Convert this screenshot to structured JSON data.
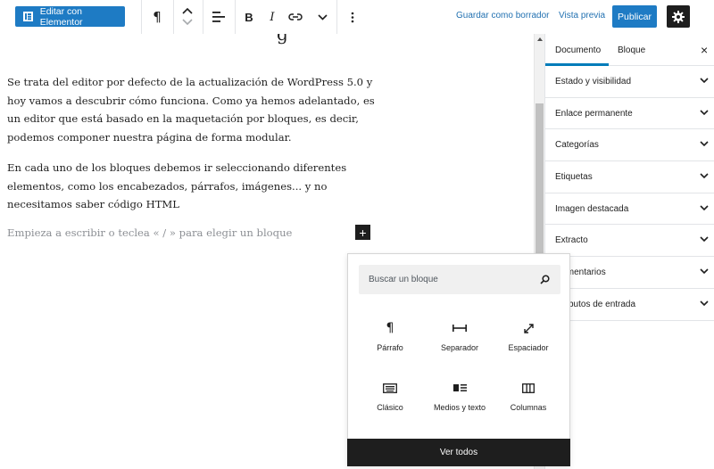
{
  "toolbar": {
    "elementor_label": "Editar con Elementor",
    "save_draft_label": "Guardar como borrador",
    "preview_label": "Vista previa",
    "publish_label": "Publicar",
    "icons": [
      "paragraph-icon",
      "move-up-icon",
      "move-down-icon",
      "align-icon",
      "bold-icon",
      "italic-icon",
      "link-icon",
      "chevron-down-icon",
      "more-options-icon",
      "settings-gear-icon"
    ]
  },
  "editor": {
    "title_remnant": "g",
    "paragraphs": [
      "Se trata del editor por defecto de la actualización de WordPress 5.0 y hoy vamos a descubrir cómo funciona. Como ya hemos adelantado, es un editor que está basado en la maquetación por bloques, es decir, podemos componer nuestra página de forma modular.",
      "En cada uno de los bloques debemos ir seleccionando diferentes elementos, como los encabezados, párrafos, imágenes... y no necesitamos saber código HTML"
    ],
    "placeholder": "Empieza a escribir o teclea « / » para elegir un bloque",
    "add_block_symbol": "+"
  },
  "sidebar": {
    "tabs": [
      "Documento",
      "Bloque"
    ],
    "active_tab": "Documento",
    "close_symbol": "×",
    "panels": [
      "Estado y visibilidad",
      "Enlace permanente",
      "Categorías",
      "Etiquetas",
      "Imagen destacada",
      "Extracto",
      "Comentarios",
      "Atributos de entrada"
    ]
  },
  "inserter": {
    "search_placeholder": "Buscar un bloque",
    "blocks": [
      {
        "label": "Párrafo",
        "icon": "paragraph-icon"
      },
      {
        "label": "Separador",
        "icon": "separator-icon"
      },
      {
        "label": "Espaciador",
        "icon": "spacer-icon"
      },
      {
        "label": "Clásico",
        "icon": "keyboard-icon"
      },
      {
        "label": "Medios y texto",
        "icon": "media-text-icon"
      },
      {
        "label": "Columnas",
        "icon": "columns-icon"
      }
    ],
    "view_all_label": "Ver todos"
  },
  "colors": {
    "accent": "#1e7bc4",
    "link": "#2271b1",
    "dark": "#1e1e1e",
    "tab_underline": "#007cba"
  }
}
